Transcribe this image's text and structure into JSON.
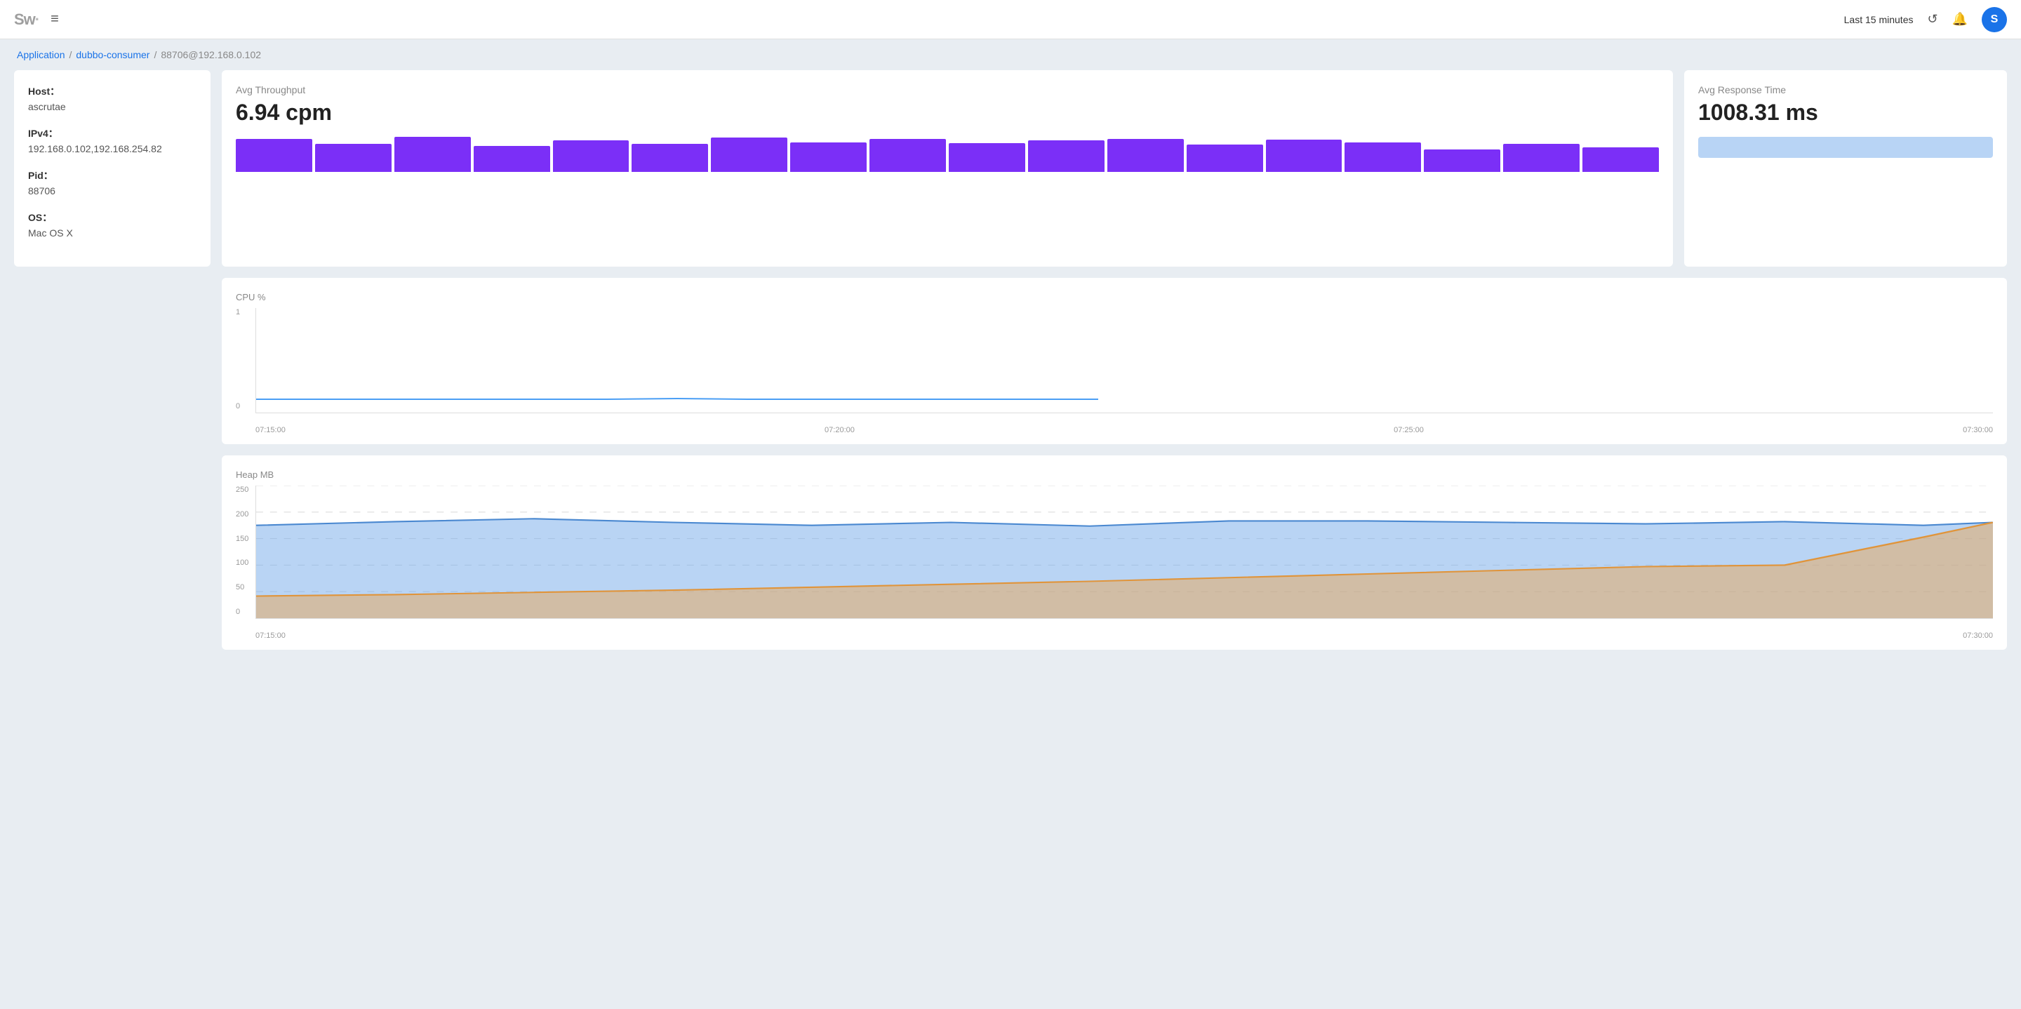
{
  "header": {
    "logo_sw": "Sw",
    "logo_dot": "·",
    "menu_icon": "≡",
    "time_range": "Last 15 minutes",
    "refresh_icon": "↺",
    "bell_icon": "🔔",
    "avatar_initial": "S"
  },
  "breadcrumb": {
    "app_label": "Application",
    "sep1": "/",
    "instance_label": "dubbo-consumer",
    "sep2": "/",
    "pid_label": "88706@192.168.0.102"
  },
  "info_card": {
    "host_label": "Host：",
    "host_value": "ascrutae",
    "ipv4_label": "IPv4：",
    "ipv4_value": "192.168.0.102,192.168.254.82",
    "pid_label": "Pid：",
    "pid_value": "88706",
    "os_label": "OS：",
    "os_value": "Mac OS X"
  },
  "throughput": {
    "title": "Avg Throughput",
    "value": "6.94 cpm",
    "bars": [
      85,
      70,
      90,
      65,
      80,
      70,
      88,
      75,
      85,
      72,
      80,
      85,
      68,
      82,
      75,
      55,
      70,
      60
    ]
  },
  "response_time": {
    "title": "Avg Response Time",
    "value": "1008.31 ms"
  },
  "cpu_chart": {
    "title": "CPU %",
    "y_labels": [
      "1",
      "0"
    ],
    "x_labels": [
      "07:15:00",
      "07:20:00",
      "07:25:00",
      "07:30:00"
    ]
  },
  "heap_chart": {
    "title": "Heap MB",
    "y_labels": [
      "250",
      "200",
      "150",
      "100",
      "50",
      "0"
    ],
    "x_labels": [
      "07:15:00",
      "07:30:00"
    ]
  }
}
